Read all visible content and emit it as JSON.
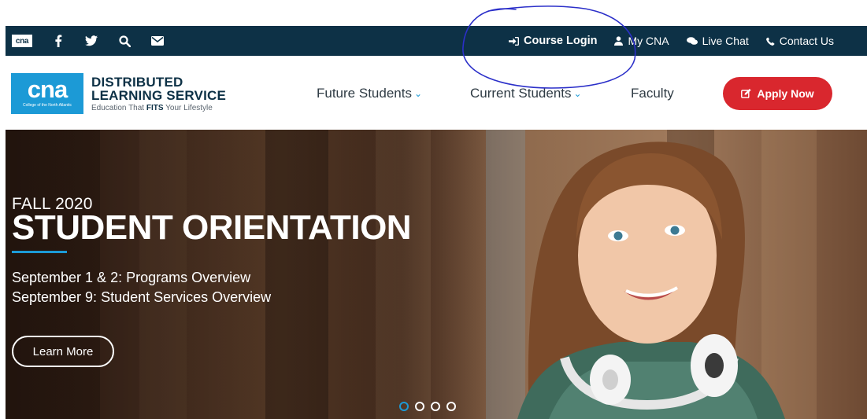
{
  "topbar": {
    "logo_text": "cna",
    "social_icons": [
      "facebook-icon",
      "twitter-icon",
      "search-icon",
      "mail-icon"
    ],
    "links": [
      {
        "label": "Course Login",
        "icon": "sign-in-icon"
      },
      {
        "label": "My CNA",
        "icon": "user-icon"
      },
      {
        "label": "Live Chat",
        "icon": "chat-icon"
      },
      {
        "label": "Contact Us",
        "icon": "phone-icon"
      }
    ]
  },
  "header": {
    "logo_main": "cna",
    "logo_sub": "College of the North Atlantic",
    "brand_line1": "DISTRIBUTED",
    "brand_line2": "LEARNING SERVICE",
    "tagline_pre": "Education That ",
    "tagline_bold": "FITS",
    "tagline_post": " Your Lifestyle",
    "nav": [
      {
        "label": "Future Students",
        "has_dropdown": true
      },
      {
        "label": "Current Students",
        "has_dropdown": true
      },
      {
        "label": "Faculty",
        "has_dropdown": false
      }
    ],
    "apply_label": "Apply Now"
  },
  "hero": {
    "eyebrow": "FALL 2020",
    "headline": "STUDENT ORIENTATION",
    "details": [
      "September 1 & 2: Programs Overview",
      "September 9: Student Services Overview"
    ],
    "cta_label": "Learn More",
    "slide_count": 4,
    "active_slide": 1
  },
  "colors": {
    "topbar_bg": "#0d3146",
    "accent_blue": "#1c9ad6",
    "apply_red": "#d9272e",
    "annotation_ink": "#2b2fc9"
  }
}
